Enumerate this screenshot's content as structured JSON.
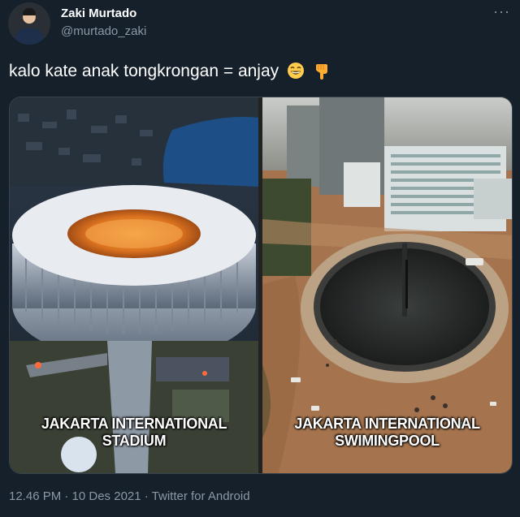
{
  "tweet": {
    "author_name": "Zaki Murtado",
    "author_handle": "@murtado_zaki",
    "more_label": "···",
    "text": "kalo kate anak tongkrongan = anjay",
    "emojis": [
      "grinning-face-emoji",
      "pointing-down-emoji"
    ],
    "media": {
      "left_caption": "JAKARTA INTERNATIONAL\nSTADIUM",
      "right_caption": "JAKARTA INTERNATIONAL\nSWIMINGPOOL"
    },
    "footer": "12.46 PM · 10 Des 2021 · Twitter for Android"
  },
  "colors": {
    "background": "#15202b",
    "secondary_text": "#8b98a5",
    "border": "#38444d"
  }
}
